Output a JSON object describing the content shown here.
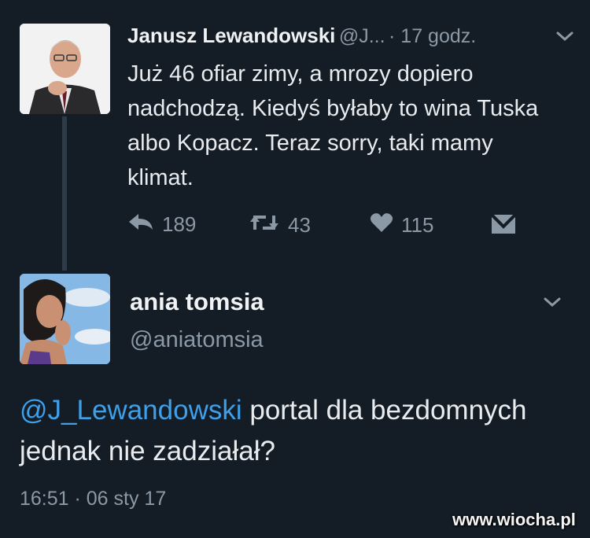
{
  "tweet1": {
    "author_name": "Janusz Lewandowski",
    "author_handle": "@J...",
    "time": "· 17 godz.",
    "text": "Już 46 ofiar zimy, a mrozy dopiero nadchodzą. Kiedyś byłaby to wina Tuska albo Kopacz. Teraz sorry, taki mamy klimat.",
    "actions": {
      "reply_count": "189",
      "retweet_count": "43",
      "like_count": "115"
    },
    "icons": [
      "reply-icon",
      "retweet-icon",
      "heart-icon",
      "dm-icon",
      "chevron-down-icon"
    ]
  },
  "tweet2": {
    "author_name": "ania tomsia",
    "author_handle": "@aniatomsia",
    "mention": "@J_Lewandowski",
    "text": " portal dla bezdomnych jednak nie zadziałał?",
    "timestamp": "16:51 · 06 sty 17"
  },
  "watermark": "www.wiocha.pl",
  "colors": {
    "background": "#141d26",
    "mention": "#3ea0ea",
    "muted": "#8b98a5",
    "text": "#e9ecef"
  }
}
